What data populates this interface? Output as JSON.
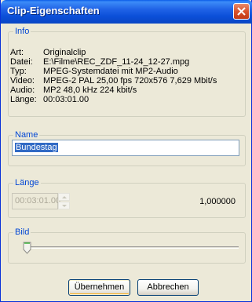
{
  "window": {
    "title": "Clip-Eigenschaften"
  },
  "info": {
    "legend": "Info",
    "rows": [
      {
        "key": "Art:",
        "value": "Originalclip"
      },
      {
        "key": "Datei:",
        "value": "E:\\Filme\\REC_ZDF_11-24_12-27.mpg"
      },
      {
        "key": "Typ:",
        "value": "MPEG-Systemdatei mit MP2-Audio"
      },
      {
        "key": "Video:",
        "value": "MPEG-2  PAL  25,00 fps  720x576  7,629 Mbit/s"
      },
      {
        "key": "Audio:",
        "value": "MP2  48,0 kHz  224 kbit/s"
      },
      {
        "key": "Länge:",
        "value": "00:03:01.00"
      }
    ]
  },
  "name": {
    "legend": "Name",
    "value": "Bundestag"
  },
  "length": {
    "legend": "Länge",
    "value": "00:03:01.00",
    "factor": "1,000000"
  },
  "image": {
    "legend": "Bild",
    "slider_position": 0
  },
  "buttons": {
    "apply": "Übernehmen",
    "cancel": "Abbrechen"
  },
  "colors": {
    "titlebar": "#0A4FD8",
    "legend_text": "#0046D5",
    "selection": "#316AC5",
    "close": "#D9532C"
  }
}
